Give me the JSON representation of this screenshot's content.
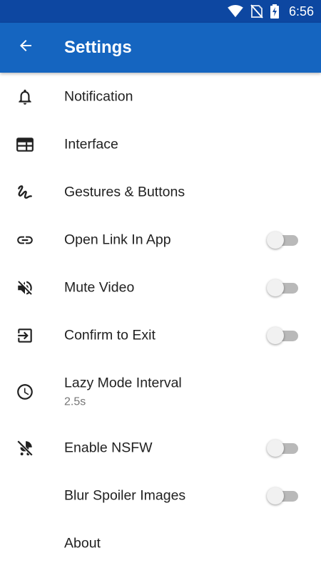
{
  "status_bar": {
    "time": "6:56"
  },
  "app_bar": {
    "title": "Settings",
    "back_icon": "arrow-left-icon"
  },
  "settings": {
    "notification": {
      "label": "Notification",
      "icon": "bell-icon"
    },
    "interface": {
      "label": "Interface",
      "icon": "web-layout-icon"
    },
    "gestures": {
      "label": "Gestures & Buttons",
      "icon": "gesture-icon"
    },
    "open_link": {
      "label": "Open Link In App",
      "icon": "link-icon",
      "enabled": false
    },
    "mute_video": {
      "label": "Mute Video",
      "icon": "volume-off-icon",
      "enabled": false
    },
    "confirm_exit": {
      "label": "Confirm to Exit",
      "icon": "exit-to-app-icon",
      "enabled": false
    },
    "lazy_mode": {
      "label": "Lazy Mode Interval",
      "value": "2.5s",
      "icon": "clock-icon"
    },
    "nsfw": {
      "label": "Enable NSFW",
      "icon": "baby-carriage-off-icon",
      "enabled": false
    },
    "blur_spoiler": {
      "label": "Blur Spoiler Images",
      "enabled": false
    },
    "about": {
      "label": "About"
    }
  },
  "colors": {
    "status_bar": "#0d47a1",
    "app_bar": "#1565c0",
    "toggle_off_track": "#b9b9b9",
    "toggle_off_thumb": "#f1f1f1"
  }
}
